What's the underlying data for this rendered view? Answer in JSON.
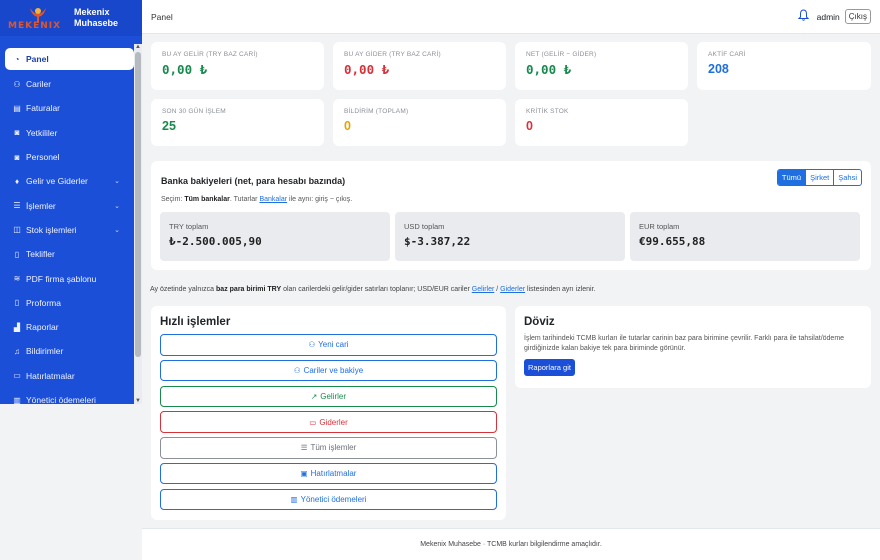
{
  "brand": {
    "logo_text": "MEKENIX",
    "name_line1": "Mekenix",
    "name_line2": "Muhasebe"
  },
  "sidebar": {
    "items": [
      {
        "label": "Panel",
        "icon": "gauge-icon",
        "glyph": "◔",
        "active": true
      },
      {
        "label": "Cariler",
        "icon": "users-icon",
        "glyph": "⚇"
      },
      {
        "label": "Faturalar",
        "icon": "receipt-icon",
        "glyph": "▤"
      },
      {
        "label": "Yetkililer",
        "icon": "person-badge-icon",
        "glyph": "◙"
      },
      {
        "label": "Personel",
        "icon": "id-card-icon",
        "glyph": "◙"
      },
      {
        "label": "Gelir ve Giderler",
        "icon": "cash-icon",
        "glyph": "♦",
        "chevron": true
      },
      {
        "label": "İşlemler",
        "icon": "list-icon",
        "glyph": "☰",
        "chevron": true
      },
      {
        "label": "Stok işlemleri",
        "icon": "box-icon",
        "glyph": "◫",
        "chevron": true
      },
      {
        "label": "Teklifler",
        "icon": "document-icon",
        "glyph": "▯"
      },
      {
        "label": "PDF firma şablonu",
        "icon": "sliders-icon",
        "glyph": "≋"
      },
      {
        "label": "Proforma",
        "icon": "file-icon",
        "glyph": "▯"
      },
      {
        "label": "Raporlar",
        "icon": "bar-chart-icon",
        "glyph": "▟"
      },
      {
        "label": "Bildirimler",
        "icon": "bell-icon",
        "glyph": "♫"
      },
      {
        "label": "Hatırlatmalar",
        "icon": "calendar-icon",
        "glyph": "▭"
      },
      {
        "label": "Yönetici ödemeleri",
        "icon": "bank-icon",
        "glyph": "▥"
      }
    ]
  },
  "topbar": {
    "breadcrumb": "Panel",
    "user": "admin",
    "logout": "Çıkış"
  },
  "stats": [
    {
      "label": "BU AY GELİR (TRY BAZ CARİ)",
      "value": "0,00 ₺"
    },
    {
      "label": "BU AY GİDER (TRY BAZ CARİ)",
      "value": "0,00 ₺"
    },
    {
      "label": "NET (GELİR − GİDER)",
      "value": "0,00 ₺"
    },
    {
      "label": "AKTİF CARİ",
      "value": "208"
    },
    {
      "label": "SON 30 GÜN İŞLEM",
      "value": "25"
    },
    {
      "label": "BİLDİRİM (TOPLAM)",
      "value": "0"
    },
    {
      "label": "KRİTİK STOK",
      "value": "0"
    }
  ],
  "bank": {
    "title": "Banka bakiyeleri (net, para hesabı bazında)",
    "filters": [
      "Tümü",
      "Şirket",
      "Şahsi"
    ],
    "selection_prefix": "Seçim: ",
    "selection_bold": "Tüm bankalar",
    "selection_mid": ". Tutarlar ",
    "selection_link": "Bankalar",
    "selection_suffix": " ile aynı: giriş − çıkış.",
    "currencies": [
      {
        "label": "TRY toplam",
        "value": "₺-2.500.005,90"
      },
      {
        "label": "USD toplam",
        "value": "$-3.387,22"
      },
      {
        "label": "EUR toplam",
        "value": "€99.655,88"
      }
    ]
  },
  "note": {
    "prefix": "Ay özetinde yalnızca ",
    "bold": "baz para birimi TRY",
    "mid": " olan carilerdeki gelir/gider satırları toplanır; USD/EUR cariler ",
    "link1": "Gelirler",
    "sep": " / ",
    "link2": "Giderler",
    "suffix": " listesinden ayrı izlenir."
  },
  "quick": {
    "title": "Hızlı işlemler",
    "buttons": [
      {
        "label": "Yeni cari",
        "icon": "person-plus-icon",
        "glyph": "⚇"
      },
      {
        "label": "Cariler ve bakiye",
        "icon": "users-icon",
        "glyph": "⚇"
      },
      {
        "label": "Gelirler",
        "icon": "trend-up-icon",
        "glyph": "↗"
      },
      {
        "label": "Giderler",
        "icon": "wallet-icon",
        "glyph": "▭"
      },
      {
        "label": "Tüm işlemler",
        "icon": "list-icon",
        "glyph": "☰"
      },
      {
        "label": "Hatırlatmalar",
        "icon": "calendar-check-icon",
        "glyph": "▣"
      },
      {
        "label": "Yönetici ödemeleri",
        "icon": "bank-icon",
        "glyph": "▥"
      }
    ]
  },
  "doviz": {
    "title": "Döviz",
    "text": "İşlem tarihindeki TCMB kurları ile tutarlar carinin baz para birimine çevrilir. Farklı para ile tahsilat/ödeme girdiğinizde kalan bakiye tek para biriminde görünür.",
    "button": "Raporlara git"
  },
  "footer": "Mekenix Muhasebe · TCMB kurları bilgilendirme amaçlıdır.",
  "colors": {
    "sidebar": "#1c4fd8",
    "primary": "#1f6fe0",
    "income": "#188a4e",
    "expense": "#d6323a",
    "warning": "#e2a400"
  }
}
